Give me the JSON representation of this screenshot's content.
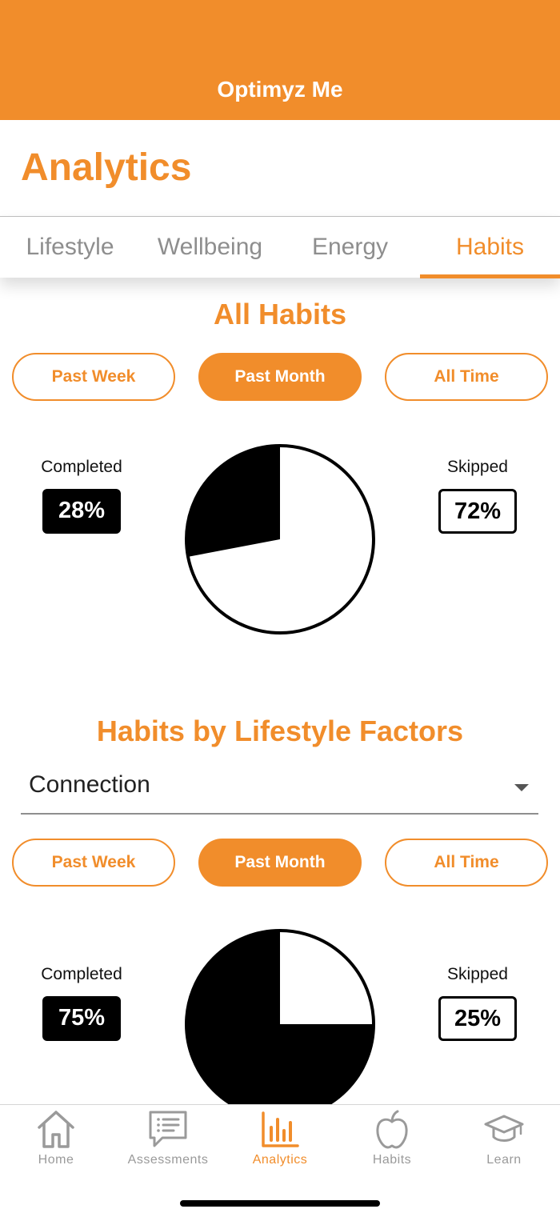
{
  "app": {
    "title": "Optimyz Me",
    "accent": "#f18d2b"
  },
  "page": {
    "title": "Analytics"
  },
  "tabs": [
    {
      "label": "Lifestyle",
      "active": false
    },
    {
      "label": "Wellbeing",
      "active": false
    },
    {
      "label": "Energy",
      "active": false
    },
    {
      "label": "Habits",
      "active": true
    }
  ],
  "all_habits": {
    "title": "All Habits",
    "filters": [
      {
        "label": "Past Week",
        "active": false
      },
      {
        "label": "Past Month",
        "active": true
      },
      {
        "label": "All Time",
        "active": false
      }
    ],
    "completed": {
      "label": "Completed",
      "value": "28%"
    },
    "skipped": {
      "label": "Skipped",
      "value": "72%"
    },
    "completed_fraction": 0.28
  },
  "lifestyle_factors": {
    "title": "Habits by Lifestyle Factors",
    "selected_factor": "Connection",
    "filters": [
      {
        "label": "Past Week",
        "active": false
      },
      {
        "label": "Past Month",
        "active": true
      },
      {
        "label": "All Time",
        "active": false
      }
    ],
    "completed": {
      "label": "Completed",
      "value": "75%"
    },
    "skipped": {
      "label": "Skipped",
      "value": "25%"
    },
    "completed_fraction": 0.75
  },
  "bottom_nav": [
    {
      "label": "Home",
      "icon": "home-icon",
      "active": false
    },
    {
      "label": "Assessments",
      "icon": "assessments-icon",
      "active": false
    },
    {
      "label": "Analytics",
      "icon": "analytics-icon",
      "active": true
    },
    {
      "label": "Habits",
      "icon": "apple-icon",
      "active": false
    },
    {
      "label": "Learn",
      "icon": "graduation-cap-icon",
      "active": false
    }
  ]
}
